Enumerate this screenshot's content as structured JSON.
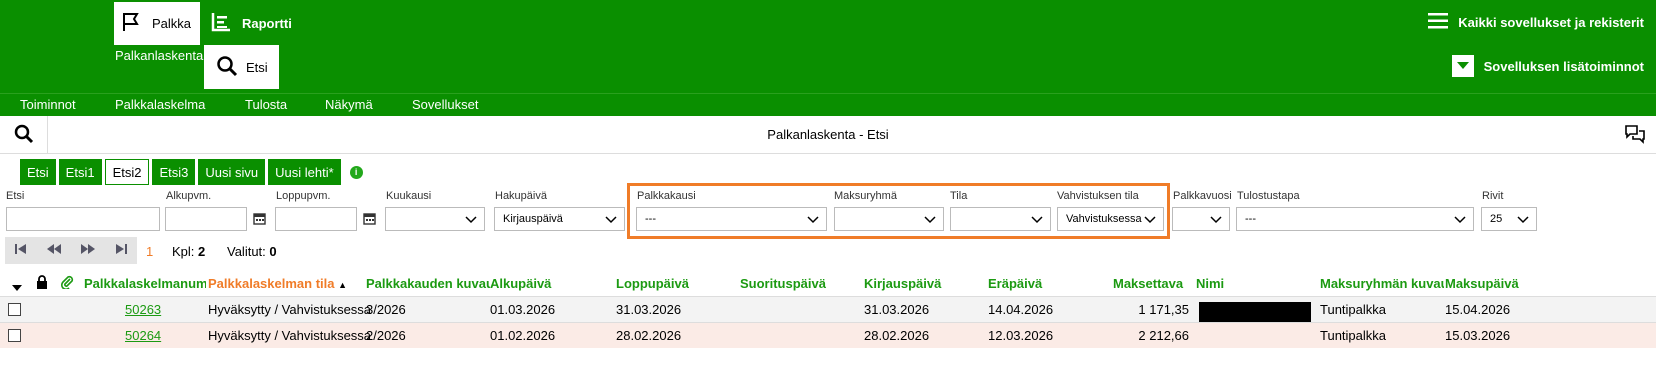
{
  "header": {
    "tab_palkka": "Palkka",
    "tab_raportti": "Raportti",
    "sub_palkanlaskenta": "Palkanlaskenta",
    "tab_etsi": "Etsi",
    "all_apps": "Kaikki sovellukset ja rekisterit",
    "app_extra": "Sovelluksen lisätoiminnot"
  },
  "menu": {
    "toiminnot": "Toiminnot",
    "palkkalaskelma": "Palkkalaskelma",
    "tulosta": "Tulosta",
    "nakyma": "Näkymä",
    "sovellukset": "Sovellukset"
  },
  "page_title": "Palkanlaskenta - Etsi",
  "sheet_tabs": [
    "Etsi",
    "Etsi1",
    "Etsi2",
    "Etsi3",
    "Uusi sivu",
    "Uusi lehti*"
  ],
  "info": "i",
  "filters": {
    "etsi": {
      "label": "Etsi",
      "value": ""
    },
    "alkupvm": {
      "label": "Alkupvm.",
      "value": ""
    },
    "loppupvm": {
      "label": "Loppupvm.",
      "value": ""
    },
    "kuukausi": {
      "label": "Kuukausi",
      "value": ""
    },
    "hakupaiva": {
      "label": "Hakupäivä",
      "value": "Kirjauspäivä"
    },
    "palkkakausi": {
      "label": "Palkkakausi",
      "value": "---"
    },
    "maksuryhma": {
      "label": "Maksuryhmä",
      "value": ""
    },
    "tila": {
      "label": "Tila",
      "value": ""
    },
    "vahvistuksen_tila": {
      "label": "Vahvistuksen tila",
      "value": "Vahvistuksessa"
    },
    "palkkavuosi": {
      "label": "Palkkavuosi",
      "value": ""
    },
    "tulostustapa": {
      "label": "Tulostustapa",
      "value": "---"
    },
    "rivit": {
      "label": "Rivit",
      "value": "25"
    }
  },
  "toolbar": {
    "page": "1",
    "kpl_label": "Kpl:",
    "kpl_value": "2",
    "valitut_label": "Valitut:",
    "valitut_value": "0"
  },
  "table": {
    "columns": {
      "numero": "Palkkalaskelmanume",
      "tila": "Palkkalaskelman tila",
      "kausi": "Palkkakauden kuvau",
      "alkupaiva": "Alkupäivä",
      "loppupaiva": "Loppupäivä",
      "suorituspaiva": "Suorituspäivä",
      "kirjauspaiva": "Kirjauspäivä",
      "erapaiva": "Eräpäivä",
      "maksettava": "Maksettava",
      "nimi": "Nimi",
      "maksuryhma": "Maksuryhmän kuvau",
      "maksupaiva": "Maksupäivä"
    },
    "rows": [
      {
        "numero": "50263",
        "tila": "Hyväksytty / Vahvistuksessa",
        "kausi": "3/2026",
        "alkupaiva": "01.03.2026",
        "loppupaiva": "31.03.2026",
        "kirjauspaiva": "31.03.2026",
        "erapaiva": "14.04.2026",
        "maksettava": "1 171,35",
        "maksuryhma": "Tuntipalkka",
        "maksupaiva": "15.04.2026"
      },
      {
        "numero": "50264",
        "tila": "Hyväksytty / Vahvistuksessa",
        "kausi": "2/2026",
        "alkupaiva": "01.02.2026",
        "loppupaiva": "28.02.2026",
        "kirjauspaiva": "28.02.2026",
        "erapaiva": "12.03.2026",
        "maksettava": "2 212,66",
        "maksuryhma": "Tuntipalkka",
        "maksupaiva": "15.03.2026"
      }
    ]
  },
  "colors": {
    "brand_green": "#0a8f00",
    "accent_orange": "#f07c28",
    "link_green": "#1c9a12"
  }
}
